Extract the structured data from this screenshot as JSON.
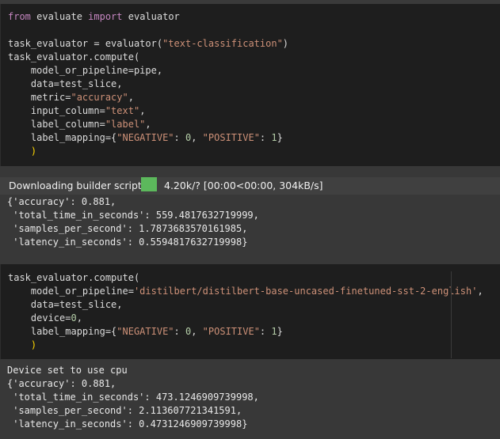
{
  "cell1": {
    "lines": [
      [
        [
          "kw",
          "from"
        ],
        [
          "txt",
          " evaluate "
        ],
        [
          "kw",
          "import"
        ],
        [
          "txt",
          " evaluator"
        ]
      ],
      [],
      [
        [
          "txt",
          "task_evaluator = evaluator("
        ],
        [
          "str",
          "\"text-classification\""
        ],
        [
          "txt",
          ")"
        ]
      ],
      [
        [
          "txt",
          "task_evaluator.compute("
        ]
      ],
      [
        [
          "txt",
          "    model_or_pipeline=pipe,"
        ]
      ],
      [
        [
          "txt",
          "    data=test_slice,"
        ]
      ],
      [
        [
          "txt",
          "    metric="
        ],
        [
          "str",
          "\"accuracy\""
        ],
        [
          "txt",
          ","
        ]
      ],
      [
        [
          "txt",
          "    input_column="
        ],
        [
          "str",
          "\"text\""
        ],
        [
          "txt",
          ","
        ]
      ],
      [
        [
          "txt",
          "    label_column="
        ],
        [
          "str",
          "\"label\""
        ],
        [
          "txt",
          ","
        ]
      ],
      [
        [
          "txt",
          "    label_mapping={"
        ],
        [
          "str",
          "\"NEGATIVE\""
        ],
        [
          "txt",
          ": "
        ],
        [
          "num",
          "0"
        ],
        [
          "txt",
          ", "
        ],
        [
          "str",
          "\"POSITIVE\""
        ],
        [
          "txt",
          ": "
        ],
        [
          "num",
          "1"
        ],
        [
          "txt",
          "}"
        ]
      ],
      [
        [
          "brk",
          "    )"
        ]
      ]
    ]
  },
  "output1": {
    "progress_label": "Downloading builder script:",
    "progress_percent": 100,
    "progress_stats": "4.20k/? [00:00<00:00, 304kB/s]",
    "lines": [
      "{'accuracy': 0.881,",
      " 'total_time_in_seconds': 559.4817632719999,",
      " 'samples_per_second': 1.7873683570161985,",
      " 'latency_in_seconds': 0.5594817632719998}"
    ]
  },
  "cell2": {
    "lines": [
      [
        [
          "txt",
          "task_evaluator.compute("
        ]
      ],
      [
        [
          "txt",
          "    model_or_pipeline="
        ],
        [
          "str",
          "'distilbert/distilbert-base-uncased-finetuned-sst-2-english'"
        ],
        [
          "txt",
          ","
        ]
      ],
      [
        [
          "txt",
          "    data=test_slice,"
        ]
      ],
      [
        [
          "txt",
          "    device="
        ],
        [
          "num",
          "0"
        ],
        [
          "txt",
          ","
        ]
      ],
      [
        [
          "txt",
          "    label_mapping={"
        ],
        [
          "str",
          "\"NEGATIVE\""
        ],
        [
          "txt",
          ": "
        ],
        [
          "num",
          "0"
        ],
        [
          "txt",
          ", "
        ],
        [
          "str",
          "\"POSITIVE\""
        ],
        [
          "txt",
          ": "
        ],
        [
          "num",
          "1"
        ],
        [
          "txt",
          "}"
        ]
      ],
      [
        [
          "brk",
          "    )"
        ]
      ]
    ]
  },
  "output2": {
    "lines": [
      "Device set to use cpu",
      "{'accuracy': 0.881,",
      " 'total_time_in_seconds': 473.1246909739998,",
      " 'samples_per_second': 2.113607721341591,",
      " 'latency_in_seconds': 0.4731246909739998}"
    ]
  }
}
